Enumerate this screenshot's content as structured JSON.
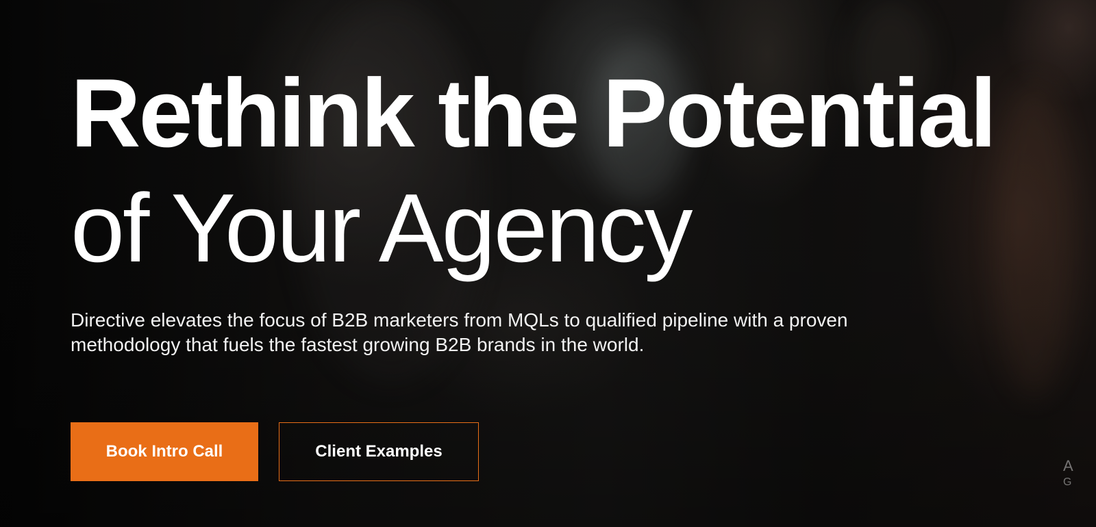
{
  "hero": {
    "headline_line1": "Rethink the Potential",
    "headline_line2": "of Your Agency",
    "subheadline": "Directive elevates the focus of B2B marketers from MQLs to qualified pipeline with a proven methodology that fuels the fastest growing B2B brands in the world.",
    "primary_button": "Book Intro Call",
    "secondary_button": "Client Examples",
    "corner_text_line1": "A",
    "corner_text_line2": "G"
  },
  "colors": {
    "accent": "#e96e17",
    "text": "#ffffff",
    "background": "#0b0b0b"
  }
}
